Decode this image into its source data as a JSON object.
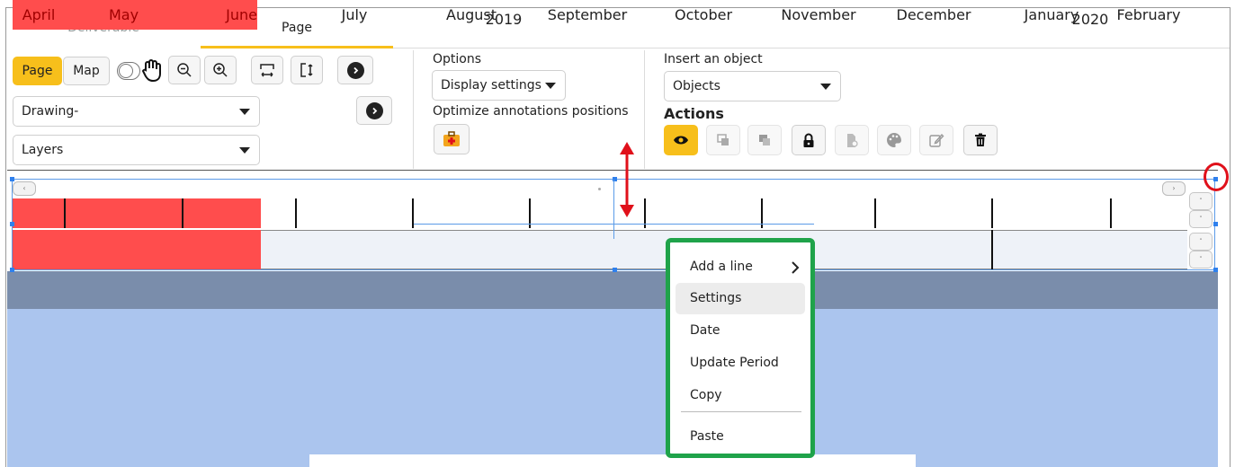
{
  "tabs": {
    "deliverable": "Deliverable",
    "page": "Page"
  },
  "toolbar": {
    "page_button": "Page",
    "map_button": "Map",
    "drawing_select": "Drawing-",
    "layers_select": "Layers"
  },
  "options": {
    "title": "Options",
    "display_settings": "Display settings",
    "optimize_label": "Optimize annotations positions"
  },
  "insert": {
    "title": "Insert an object",
    "objects_select": "Objects",
    "actions_title": "Actions"
  },
  "timeline": {
    "months": [
      "April",
      "May",
      "June",
      "July",
      "August",
      "September",
      "October",
      "November",
      "December",
      "January",
      "February"
    ],
    "years": [
      "2019",
      "2020"
    ]
  },
  "context_menu": {
    "items": [
      "Add a line",
      "Settings",
      "Date",
      "Update Period",
      "Copy",
      "Paste"
    ]
  },
  "colors": {
    "accent": "#f7bf1b",
    "highlight_red": "#ff4d4d",
    "menu_border": "#1fa34a",
    "band_gray": "#7a8dab",
    "canvas_blue": "#abc5ee",
    "annotation_red": "#e0101a"
  }
}
